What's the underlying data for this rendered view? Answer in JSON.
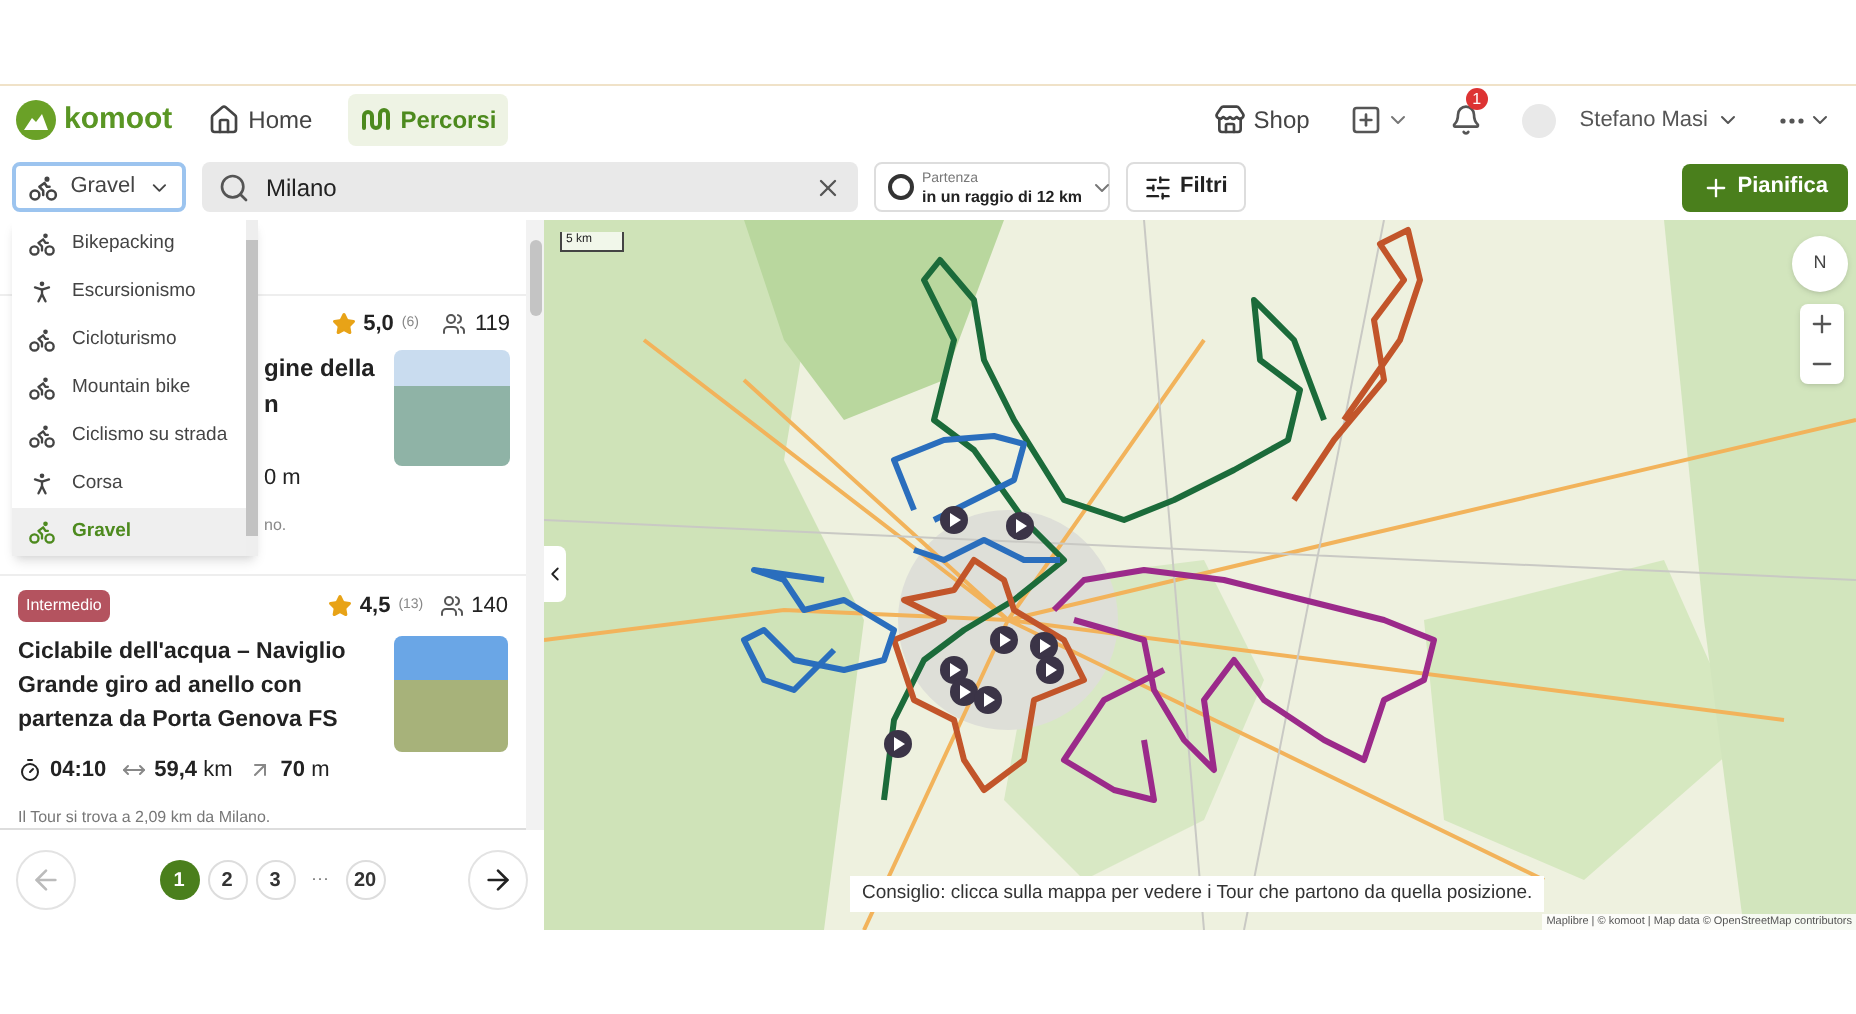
{
  "header": {
    "logo": "komoot",
    "nav": [
      {
        "label": "Home",
        "kind": "home",
        "selected": false
      },
      {
        "label": "Percorsi",
        "kind": "routes",
        "selected": true
      }
    ],
    "shop": "Shop",
    "notification_count": "1",
    "user": "Stefano Masi"
  },
  "toolbar": {
    "sport": "Gravel",
    "search": "Milano",
    "start_label": "Partenza",
    "start_value": "in un raggio di 12 km",
    "filters": "Filtri",
    "plan": "Pianifica"
  },
  "sport_menu": [
    {
      "label": "Bikepacking",
      "kind": "bike",
      "selected": false
    },
    {
      "label": "Escursionismo",
      "kind": "walk",
      "selected": false
    },
    {
      "label": "Cicloturismo",
      "kind": "bike",
      "selected": false
    },
    {
      "label": "Mountain bike",
      "kind": "bike",
      "selected": false
    },
    {
      "label": "Ciclismo su strada",
      "kind": "bike",
      "selected": false
    },
    {
      "label": "Corsa",
      "kind": "walk",
      "selected": false
    },
    {
      "label": "Gravel",
      "kind": "bike",
      "selected": true
    }
  ],
  "tours": [
    {
      "rating": "5,0",
      "reviews": "(6)",
      "users": "119",
      "title_lines": [
        "gine della",
        "n"
      ],
      "elevation": "0 m",
      "note": "no."
    },
    {
      "difficulty": "Intermedio",
      "rating": "4,5",
      "reviews": "(13)",
      "users": "140",
      "title": "Ciclabile dell'acqua – Naviglio Grande giro ad anello con partenza da Porta Genova FS",
      "duration": "04:10",
      "distance": "59,4",
      "distance_unit": "km",
      "elevation": "70",
      "elevation_unit": "m",
      "note": "Il Tour si trova a 2,09 km da Milano."
    }
  ],
  "pagination": {
    "pages": [
      {
        "label": "1",
        "selected": true
      },
      {
        "label": "2",
        "selected": false
      },
      {
        "label": "3",
        "selected": false
      },
      {
        "label": "20",
        "selected": false
      }
    ],
    "ellipsis": "···"
  },
  "map": {
    "scale": "5 km",
    "compass": "N",
    "tip": "Consiglio: clicca sulla mappa per vedere i Tour che partono da quella posizione.",
    "attribution": "Maplibre | © komoot | Map data © OpenStreetMap contributors"
  }
}
